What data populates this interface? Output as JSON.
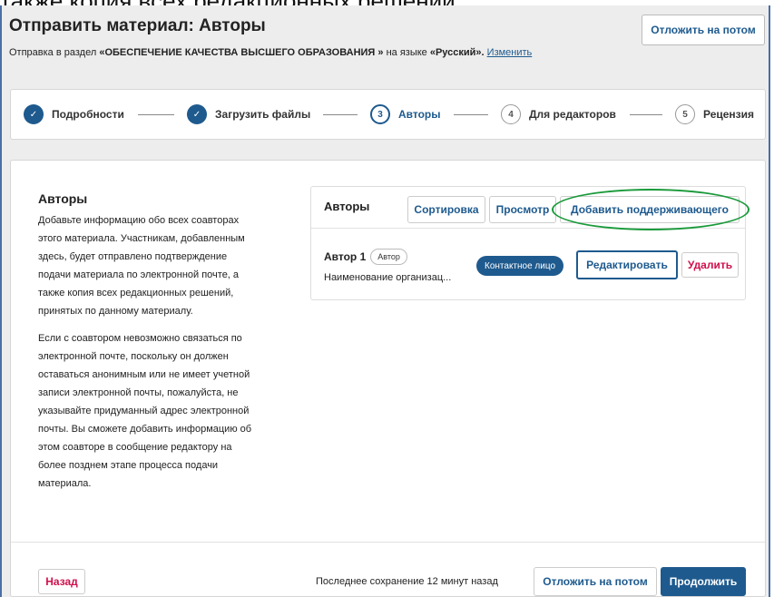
{
  "background_text": "также копия всех редакционных решений.",
  "page": {
    "title": "Отправить материал: Авторы",
    "defer_label": "Отложить на потом",
    "section_prefix": "Отправка в раздел ",
    "section_name": "«ОБЕСПЕЧЕНИЕ КАЧЕСТВА ВЫСШЕГО ОБРАЗОВАНИЯ »",
    "language_prefix": " на языке ",
    "language_name": "«Русский».",
    "change_link": "Изменить"
  },
  "steps": [
    {
      "label": "Подробности",
      "marker": "✓",
      "state": "done"
    },
    {
      "label": "Загрузить файлы",
      "marker": "✓",
      "state": "done"
    },
    {
      "label": "Авторы",
      "marker": "3",
      "state": "active"
    },
    {
      "label": "Для редакторов",
      "marker": "4",
      "state": "todo"
    },
    {
      "label": "Рецензия",
      "marker": "5",
      "state": "todo"
    }
  ],
  "left": {
    "title": "Авторы",
    "para1": "Добавьте информацию обо всех соавторах\nэтого материала. Участникам, добавленным\nздесь, будет отправлено подтверждение\nподачи материала по электронной почте, а\nтакже копия всех редакционных решений,\nпринятых по данному материалу.",
    "para2": "Если с соавтором невозможно связаться по\nэлектронной почте, поскольку он должен\nоставаться анонимным или не имеет учетной\nзаписи электронной почты, пожалуйста, не\nуказывайте придуманный адрес электронной\nпочты. Вы сможете добавить информацию об\nэтом соавторе в сообщение редактору на\nболее позднем этапе процесса подачи\nматериала."
  },
  "grid": {
    "title": "Авторы",
    "sort_label": "Сортировка",
    "preview_label": "Просмотр",
    "add_label": "Добавить поддерживающего",
    "author": {
      "name": "Автор 1",
      "role": "Автор",
      "affiliation": "Наименование организац...",
      "contact_badge": "Контактное лицо",
      "edit_label": "Редактировать",
      "delete_label": "Удалить"
    }
  },
  "footer": {
    "back_label": "Назад",
    "last_saved": "Последнее сохранение 12 минут назад",
    "defer_label": "Отложить на потом",
    "continue_label": "Продолжить"
  },
  "colors": {
    "accent": "#1e5a8e",
    "danger": "#d0104c",
    "highlight": "#1a9a3a"
  }
}
